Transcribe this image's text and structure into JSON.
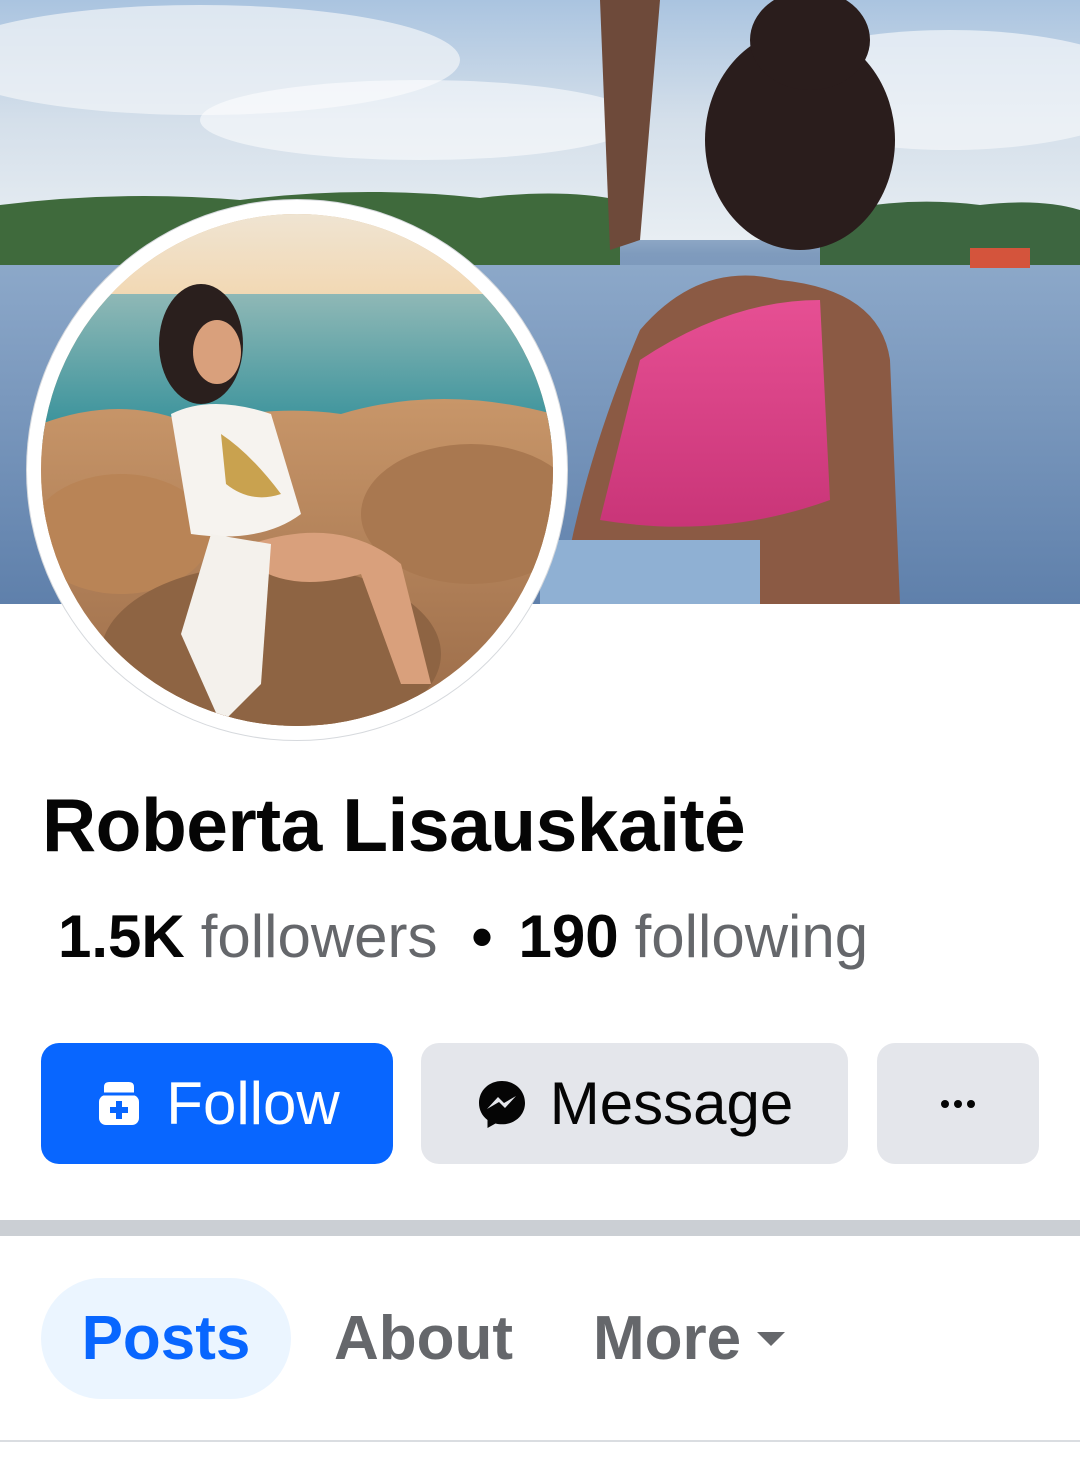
{
  "profile": {
    "name": "Roberta Lisauskaitė",
    "followers_count": "1.5K",
    "followers_label": "followers",
    "separator": "•",
    "following_count": "190",
    "following_label": "following"
  },
  "actions": {
    "follow_label": "Follow",
    "message_label": "Message",
    "more_label": "···",
    "follow_icon": "add-friend-icon",
    "message_icon": "messenger-icon"
  },
  "tabs": [
    {
      "label": "Posts",
      "active": true
    },
    {
      "label": "About",
      "active": false
    },
    {
      "label": "More",
      "active": false,
      "icon": "caret-down-icon"
    }
  ],
  "colors": {
    "primary": "#0866ff",
    "button_secondary": "#e4e6eb",
    "text_primary": "#050505",
    "text_secondary": "#65676b",
    "active_tab_bg": "#ebf5ff",
    "divider": "#cbcfd4"
  }
}
